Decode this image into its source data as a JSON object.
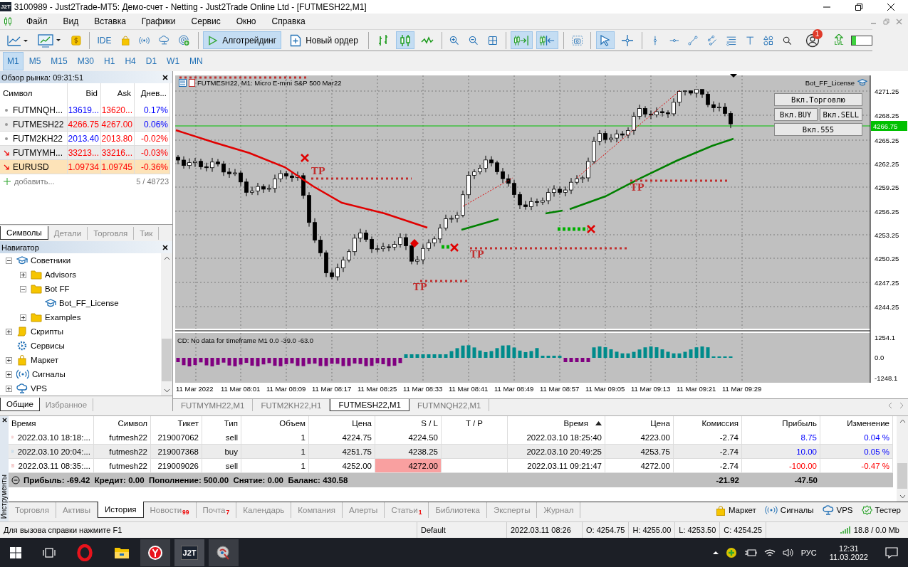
{
  "window": {
    "badge": "J2T",
    "title": "3100989 - Just2Trade-MT5: Демо-счет - Netting - Just2Trade Online Ltd - [FUTMESH22,M1]"
  },
  "menu": [
    "Файл",
    "Вид",
    "Вставка",
    "Графики",
    "Сервис",
    "Окно",
    "Справка"
  ],
  "toolbar": {
    "ide": "IDE",
    "algo_trading": {
      "label": "Алготрейдинг",
      "on": true
    },
    "new_order": "Новый ордер",
    "chart_modes": [
      {
        "selected": false
      },
      {
        "selected": true
      },
      {
        "selected": false
      }
    ],
    "autoscroll": {
      "on": true
    },
    "chart_shift": {
      "on": true
    },
    "cursor": {
      "selected": true
    },
    "crosshair": {
      "selected": false
    },
    "notifications": "1",
    "lvl": "LVL",
    "meter": {
      "level": 0.2
    }
  },
  "timeframes": [
    {
      "label": "M1",
      "selected": true
    },
    {
      "label": "M5",
      "selected": false
    },
    {
      "label": "M15",
      "selected": false
    },
    {
      "label": "M30",
      "selected": false
    },
    {
      "label": "H1",
      "selected": false
    },
    {
      "label": "H4",
      "selected": false
    },
    {
      "label": "D1",
      "selected": false
    },
    {
      "label": "W1",
      "selected": false
    },
    {
      "label": "MN",
      "selected": false
    }
  ],
  "market_watch": {
    "title": "Обзор рынка: 09:31:51",
    "columns": [
      "Символ",
      "Bid",
      "Ask",
      "Днев..."
    ],
    "rows": [
      {
        "kind": "dot",
        "symbol": "FUTMNQH...",
        "bid": {
          "text": "13619...",
          "color": "#0000ff"
        },
        "ask": {
          "text": "13620...",
          "color": "#ff0000"
        },
        "change": {
          "text": "0.17%",
          "color": "#0000ff"
        },
        "selected": false
      },
      {
        "kind": "dot",
        "symbol": "FUTMESH22",
        "bid": {
          "text": "4266.75",
          "color": "#ff0000"
        },
        "ask": {
          "text": "4267.00",
          "color": "#ff0000"
        },
        "change": {
          "text": "0.06%",
          "color": "#0000ff"
        },
        "selected": false
      },
      {
        "kind": "dot",
        "symbol": "FUTM2KH22",
        "bid": {
          "text": "2013.40",
          "color": "#0000ff"
        },
        "ask": {
          "text": "2013.80",
          "color": "#ff0000"
        },
        "change": {
          "text": "-0.02%",
          "color": "#ff0000"
        },
        "selected": false
      },
      {
        "kind": "down",
        "symbol": "FUTMYMH...",
        "bid": {
          "text": "33213...",
          "color": "#ff0000"
        },
        "ask": {
          "text": "33216...",
          "color": "#ff0000"
        },
        "change": {
          "text": "-0.03%",
          "color": "#ff0000"
        },
        "selected": false
      },
      {
        "kind": "down",
        "symbol": "EURUSD",
        "bid": {
          "text": "1.09734",
          "color": "#ff0000"
        },
        "ask": {
          "text": "1.09745",
          "color": "#ff0000"
        },
        "change": {
          "text": "-0.36%",
          "color": "#ff0000"
        },
        "selected": true
      }
    ],
    "add": "добавить...",
    "count": "5 / 48723",
    "tabs": [
      {
        "label": "Символы",
        "selected": true
      },
      {
        "label": "Детали",
        "selected": false
      },
      {
        "label": "Торговля",
        "selected": false
      },
      {
        "label": "Тик",
        "selected": false
      }
    ]
  },
  "navigator": {
    "title": "Навигатор",
    "tree": [
      {
        "label": "Советники",
        "kind": "expert",
        "expandable": true,
        "expanded": true,
        "children": [
          {
            "label": "Advisors",
            "kind": "folder",
            "expandable": true,
            "expanded": false
          },
          {
            "label": "Bot FF",
            "kind": "folder",
            "expandable": true,
            "expanded": true,
            "children": [
              {
                "label": "Bot_FF_License",
                "kind": "expert",
                "expandable": false
              }
            ]
          },
          {
            "label": "Examples",
            "kind": "folder",
            "expandable": true,
            "expanded": false
          }
        ]
      },
      {
        "label": "Скрипты",
        "kind": "script",
        "expandable": true,
        "expanded": false
      },
      {
        "label": "Сервисы",
        "kind": "service",
        "expandable": false
      },
      {
        "label": "Маркет",
        "kind": "market",
        "expandable": true,
        "expanded": false
      },
      {
        "label": "Сигналы",
        "kind": "signal",
        "expandable": true,
        "expanded": false
      },
      {
        "label": "VPS",
        "kind": "vps",
        "expandable": true,
        "expanded": false
      }
    ],
    "tabs": [
      {
        "label": "Общие",
        "selected": true
      },
      {
        "label": "Избранное",
        "selected": false
      }
    ]
  },
  "chart": {
    "caption": "FUTMESH22, M1: Micro E-mini S&P 500 Mar22",
    "expert": "Bot_FF_License",
    "buttons": [
      "Вкл.Торговлю",
      "Вкл.BUY",
      "Вкл.SELL",
      "Вкл.555"
    ],
    "price_labels": [
      "4271.25",
      "4268.25",
      "4265.25",
      "4262.25",
      "4259.25",
      "4256.25",
      "4253.25",
      "4250.25",
      "4247.25",
      "4244.25"
    ],
    "current_price": "4266.75",
    "tp_labels": [
      "TP",
      "TP",
      "TP",
      "TP"
    ],
    "indicator": {
      "caption": "CD: No data for timeframe M1 0.0 -39.0 -63.0",
      "labels": [
        "1254.1",
        "0.0",
        "-1248.1"
      ]
    },
    "time_labels": [
      "11 Mar 2022",
      "11 Mar 08:01",
      "11 Mar 08:09",
      "11 Mar 08:17",
      "11 Mar 08:25",
      "11 Mar 08:33",
      "11 Mar 08:41",
      "11 Mar 08:49",
      "11 Mar 08:57",
      "11 Mar 09:05",
      "11 Mar 09:13",
      "11 Mar 09:21",
      "11 Mar 09:29"
    ]
  },
  "chart_tabs": [
    {
      "label": "FUTMYMH22,M1",
      "selected": false
    },
    {
      "label": "FUTM2KH22,H1",
      "selected": false
    },
    {
      "label": "FUTMESH22,M1",
      "selected": true
    },
    {
      "label": "FUTMNQH22,M1",
      "selected": false
    }
  ],
  "toolbox": {
    "side_label": "Инструменты",
    "columns": [
      {
        "label": "Время",
        "sorted": false
      },
      {
        "label": "Символ",
        "sorted": false
      },
      {
        "label": "Тикет",
        "sorted": false
      },
      {
        "label": "Тип",
        "sorted": false
      },
      {
        "label": "Объем",
        "sorted": false
      },
      {
        "label": "Цена",
        "sorted": false
      },
      {
        "label": "S / L",
        "sorted": false
      },
      {
        "label": "T / P",
        "sorted": false
      },
      {
        "label": "Время",
        "sorted": true
      },
      {
        "label": "Цена",
        "sorted": false
      },
      {
        "label": "Комиссия",
        "sorted": false
      },
      {
        "label": "Прибыль",
        "sorted": false
      },
      {
        "label": "Изменение",
        "sorted": false
      }
    ],
    "rows": [
      {
        "kind": "sell",
        "cells": [
          "2022.03.10 18:18:...",
          "futmesh22",
          "219007062",
          "sell",
          "1",
          "4224.75",
          "4224.50",
          "",
          "2022.03.10 18:25:40",
          "4223.00",
          "-2.74",
          "8.75",
          "0.04 %"
        ],
        "sl_hit": false,
        "color": "#0000ff"
      },
      {
        "kind": "buy",
        "cells": [
          "2022.03.10 20:04:...",
          "futmesh22",
          "219007368",
          "buy",
          "1",
          "4251.75",
          "4238.25",
          "",
          "2022.03.10 20:49:25",
          "4253.75",
          "-2.74",
          "10.00",
          "0.05 %"
        ],
        "sl_hit": false,
        "color": "#0000ff"
      },
      {
        "kind": "sell",
        "cells": [
          "2022.03.11 08:35:...",
          "futmesh22",
          "219009026",
          "sell",
          "1",
          "4252.00",
          "4272.00",
          "",
          "2022.03.11 09:21:47",
          "4272.00",
          "-2.74",
          "-100.00",
          "-0.47 %"
        ],
        "sl_hit": true,
        "color": "#ff0000"
      }
    ],
    "summary": {
      "text": "Прибыль: -69.42  Кредит: 0.00  Пополнение: 500.00  Снятие: 0.00  Баланс: 430.58",
      "commission": "-21.92",
      "profit": "-47.50"
    },
    "tabs": [
      {
        "label": "Торговля",
        "selected": false
      },
      {
        "label": "Активы",
        "selected": false
      },
      {
        "label": "История",
        "selected": true
      },
      {
        "label": "Новости",
        "badge": "99",
        "selected": false
      },
      {
        "label": "Почта",
        "badge": "7",
        "selected": false
      },
      {
        "label": "Календарь",
        "selected": false
      },
      {
        "label": "Компания",
        "selected": false
      },
      {
        "label": "Алерты",
        "selected": false
      },
      {
        "label": "Статьи",
        "badge": "1",
        "selected": false
      },
      {
        "label": "Библиотека",
        "selected": false
      },
      {
        "label": "Эксперты",
        "selected": false
      },
      {
        "label": "Журнал",
        "selected": false
      }
    ],
    "links": [
      {
        "kind": "market",
        "label": "Маркет"
      },
      {
        "kind": "signal",
        "label": "Сигналы"
      },
      {
        "kind": "vps",
        "label": "VPS"
      },
      {
        "kind": "tester",
        "label": "Тестер"
      }
    ]
  },
  "status_bar": {
    "help": "Для вызова справки нажмите F1",
    "profile": "Default",
    "time": "2022.03.11 08:26",
    "open": "O: 4254.75",
    "high": "H: 4255.00",
    "low": "L: 4253.50",
    "close": "C: 4254.25",
    "traffic": "18.8 / 0.0 Mb"
  },
  "taskbar": {
    "app_badge": "J2T",
    "language": "РУС",
    "time": "12:31",
    "date": "11.03.2022"
  }
}
